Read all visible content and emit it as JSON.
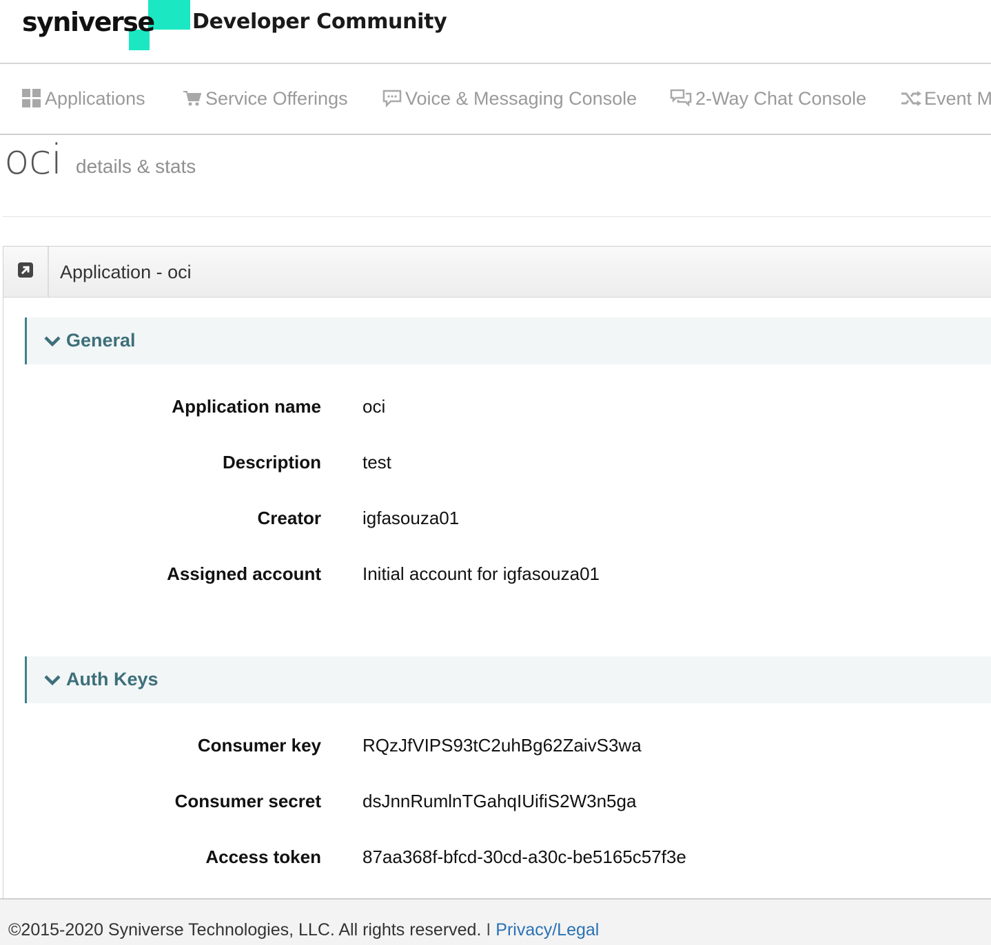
{
  "header": {
    "logo_text": "syniverse",
    "site_title": "Developer Community",
    "brand_color": "#1be8c3"
  },
  "nav": {
    "items": [
      {
        "label": "Applications",
        "icon": "grid-icon"
      },
      {
        "label": "Service Offerings",
        "icon": "cart-icon"
      },
      {
        "label": "Voice & Messaging Console",
        "icon": "comment-icon"
      },
      {
        "label": "2-Way Chat Console",
        "icon": "comments-icon"
      },
      {
        "label": "Event M",
        "icon": "shuffle-icon"
      }
    ]
  },
  "page": {
    "title": "oci",
    "subtitle": "details & stats"
  },
  "panel": {
    "title": "Application - oci",
    "icon": "external-link-icon"
  },
  "general": {
    "title": "General",
    "rows": [
      {
        "label": "Application name",
        "value": "oci"
      },
      {
        "label": "Description",
        "value": "test"
      },
      {
        "label": "Creator",
        "value": "igfasouza01"
      },
      {
        "label": "Assigned account",
        "value": "Initial account for igfasouza01"
      }
    ]
  },
  "auth_keys": {
    "title": "Auth Keys",
    "rows": [
      {
        "label": "Consumer key",
        "value": "RQzJfVIPS93tC2uhBg62ZaivS3wa"
      },
      {
        "label": "Consumer secret",
        "value": "dsJnnRumlnTGahqIUifiS2W3n5ga"
      },
      {
        "label": "Access token",
        "value": "87aa368f-bfcd-30cd-a30c-be5165c57f3e"
      }
    ]
  },
  "footer": {
    "copyright": "©2015-2020 Syniverse Technologies, LLC. All rights reserved.",
    "separator": "I",
    "link": "Privacy/Legal"
  },
  "colors": {
    "accent": "#3d7f8c",
    "section_title": "#3d6f7a",
    "link": "#2a72b5"
  }
}
